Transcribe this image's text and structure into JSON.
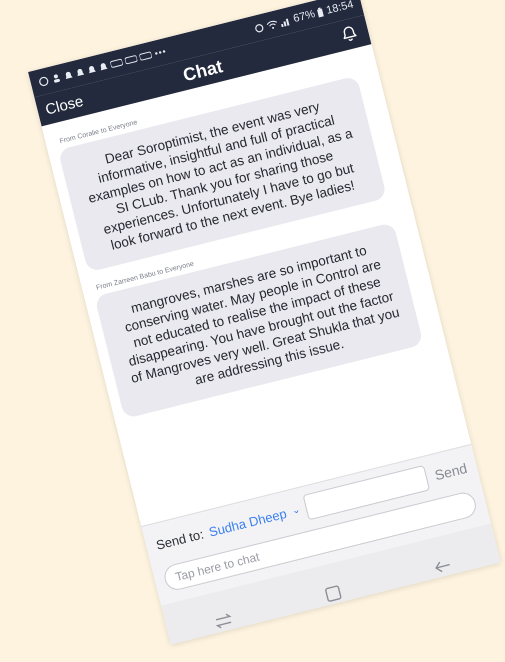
{
  "status_bar": {
    "battery": "67%",
    "time": "18:54"
  },
  "header": {
    "close_label": "Close",
    "title": "Chat"
  },
  "messages": [
    {
      "from": "From Coralie to Everyone",
      "text": "Dear Soroptimist, the event was very informative, insightful and full of practical examples on how to act as an individual, as a SI CLub. Thank you for sharing those experiences. Unfortunately I have to go but look forward to the next event. Bye ladies!"
    },
    {
      "from": "From Zarreen Babu to Everyone",
      "text": "mangroves, marshes are so important to conserving water. May people in Control are not educated to realise the impact of these disappearing. You have brought out the factor of Mangroves very well. Great Shukla that you are addressing this issue."
    }
  ],
  "composer": {
    "send_to_label": "Send to:",
    "send_to_value": "Sudha Dheep",
    "send_label": "Send",
    "placeholder": "Tap here to chat"
  },
  "colors": {
    "header_bg": "#232a3d",
    "bubble_bg": "#e9e9ef",
    "accent": "#3a7ff0",
    "page_bg": "#fdf3df"
  }
}
